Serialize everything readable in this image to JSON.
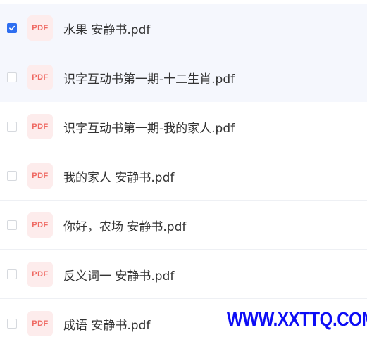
{
  "files": [
    {
      "name": "水果 安静书.pdf",
      "checked": true,
      "badge": "PDF",
      "icon": "pdf-file-icon"
    },
    {
      "name": "识字互动书第一期-十二生肖.pdf",
      "checked": false,
      "badge": "PDF",
      "icon": "pdf-file-icon"
    },
    {
      "name": "识字互动书第一期-我的家人.pdf",
      "checked": false,
      "badge": "PDF",
      "icon": "pdf-file-icon"
    },
    {
      "name": "我的家人 安静书.pdf",
      "checked": false,
      "badge": "PDF",
      "icon": "pdf-file-icon"
    },
    {
      "name": "你好，农场 安静书.pdf",
      "checked": false,
      "badge": "PDF",
      "icon": "pdf-file-icon"
    },
    {
      "name": "反义词一 安静书.pdf",
      "checked": false,
      "badge": "PDF",
      "icon": "pdf-file-icon"
    },
    {
      "name": "成语 安静书.pdf",
      "checked": false,
      "badge": "PDF",
      "icon": "pdf-file-icon"
    }
  ],
  "watermark": "WWW.XXTTQ.COM",
  "colors": {
    "accent": "#2e6ef0",
    "pdf_badge_bg": "#fdecec",
    "pdf_badge_text": "#ef6a63",
    "selected_row_bg": "#f5f7fd",
    "watermark": "#0d0df5"
  }
}
